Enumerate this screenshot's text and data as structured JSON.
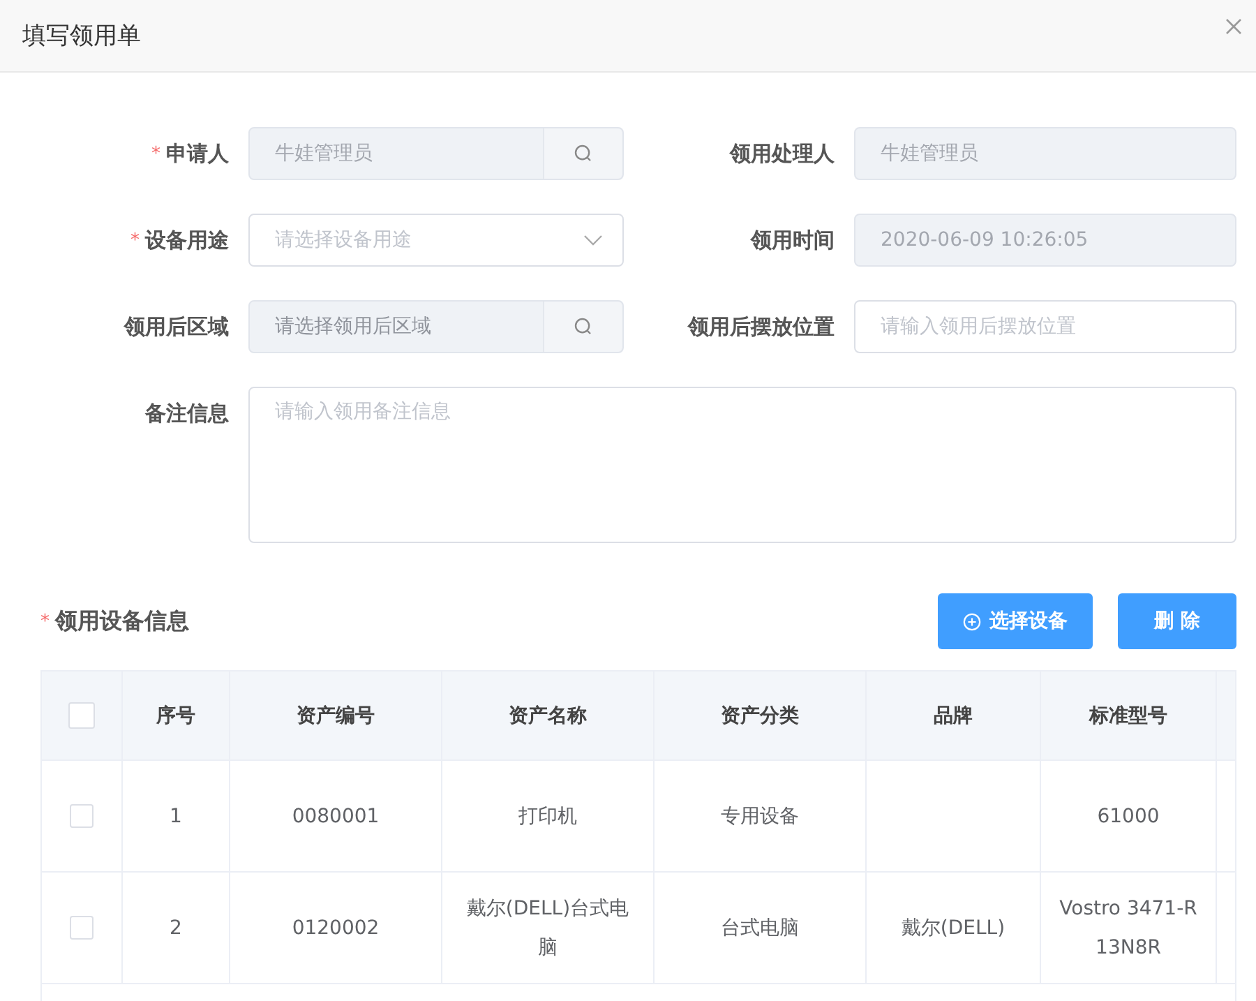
{
  "dialog": {
    "title": "填写领用单"
  },
  "form": {
    "fields": [
      {
        "label": "申请人",
        "required_mark": "*",
        "kind": "search",
        "disabled": true,
        "value": "牛娃管理员"
      },
      {
        "label": "领用处理人",
        "kind": "text",
        "disabled": true,
        "value": "牛娃管理员"
      },
      {
        "label": "设备用途",
        "required_mark": "*",
        "kind": "select",
        "disabled": false,
        "placeholder": "请选择设备用途"
      },
      {
        "label": "领用时间",
        "kind": "text",
        "disabled": true,
        "value": "2020-06-09 10:26:05"
      },
      {
        "label": "领用后区域",
        "kind": "search",
        "disabled": true,
        "placeholder": "请选择领用后区域"
      },
      {
        "label": "领用后摆放位置",
        "kind": "text",
        "disabled": false,
        "placeholder": "请输入领用后摆放位置"
      },
      {
        "label": "备注信息",
        "kind": "textarea",
        "disabled": false,
        "placeholder": "请输入领用备注信息"
      }
    ]
  },
  "equipment": {
    "title": "领用设备信息",
    "required_mark": "*",
    "buttons": [
      {
        "label": "选择设备",
        "kind": "add"
      },
      {
        "label": "删 除",
        "kind": "plain"
      }
    ],
    "table": {
      "header_checked": false,
      "columns": [
        "序号",
        "资产编号",
        "资产名称",
        "资产分类",
        "品牌",
        "标准型号"
      ],
      "rows": [
        {
          "checked": false,
          "cells": [
            "1",
            "0080001",
            "打印机",
            "专用设备",
            "",
            "61000"
          ]
        },
        {
          "checked": false,
          "cells": [
            "2",
            "0120002",
            "戴尔(DELL)台式电脑",
            "台式电脑",
            "戴尔(DELL)",
            "Vostro 3471-R 13N8R"
          ]
        }
      ]
    }
  }
}
